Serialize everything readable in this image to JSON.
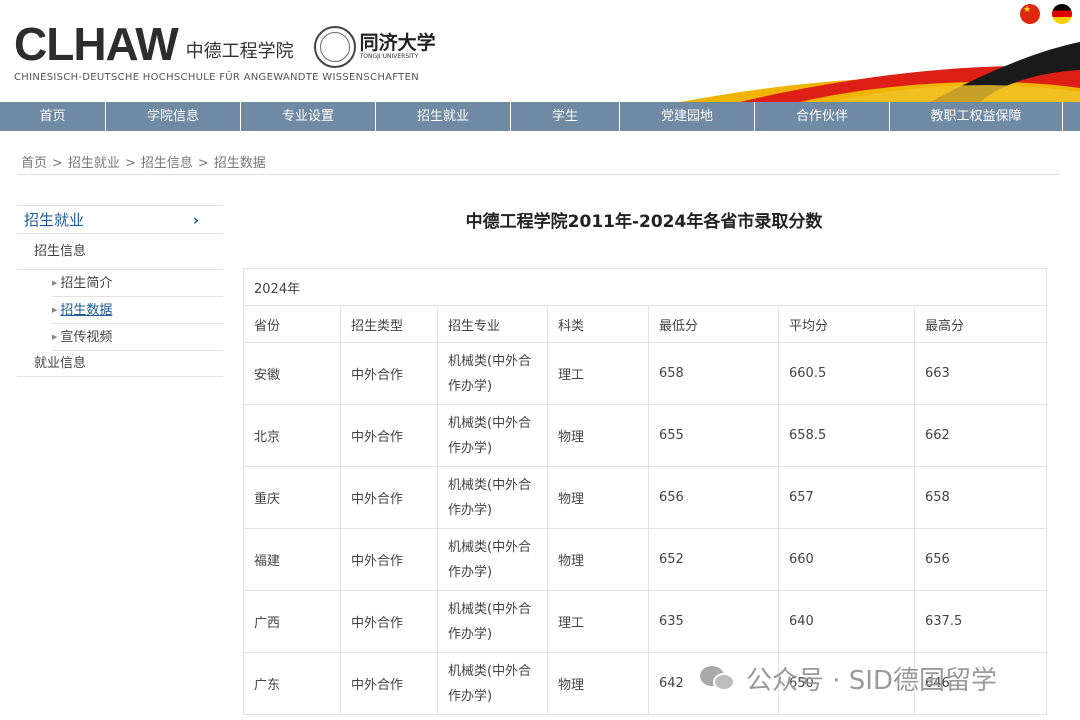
{
  "header": {
    "logo_text": "CLHAW",
    "logo_cn": "中德工程学院",
    "tongji_cn": "同济大学",
    "tongji_en": "TONGJI UNIVERSITY",
    "subtitle": "CHINESISCH-DEUTSCHE HOCHSCHULE FÜR ANGEWANDTE WISSENSCHAFTEN",
    "flags": [
      "china-flag-icon",
      "germany-flag-icon"
    ]
  },
  "nav": {
    "items": [
      {
        "label": "首页"
      },
      {
        "label": "学院信息"
      },
      {
        "label": "专业设置"
      },
      {
        "label": "招生就业"
      },
      {
        "label": "学生"
      },
      {
        "label": "党建园地"
      },
      {
        "label": "合作伙伴"
      },
      {
        "label": "教职工权益保障"
      }
    ]
  },
  "breadcrumb": {
    "items": [
      "首页",
      "招生就业",
      "招生信息",
      "招生数据"
    ],
    "sep": ">"
  },
  "sidebar": {
    "heading": "招生就业",
    "section1": "招生信息",
    "subitems": [
      "招生简介",
      "招生数据",
      "宣传视频"
    ],
    "section2": "就业信息"
  },
  "content": {
    "title": "中德工程学院2011年-2024年各省市录取分数",
    "year": "2024年",
    "headers": [
      "省份",
      "招生类型",
      "招生专业",
      "科类",
      "最低分",
      "平均分",
      "最高分"
    ],
    "rows": [
      {
        "province": "安徽",
        "type": "中外合作",
        "major": "机械类(中外合作办学)",
        "category": "理工",
        "min": "658",
        "avg": "660.5",
        "max": "663"
      },
      {
        "province": "北京",
        "type": "中外合作",
        "major": "机械类(中外合作办学)",
        "category": "物理",
        "min": "655",
        "avg": "658.5",
        "max": "662"
      },
      {
        "province": "重庆",
        "type": "中外合作",
        "major": "机械类(中外合作办学)",
        "category": "物理",
        "min": "656",
        "avg": "657",
        "max": "658"
      },
      {
        "province": "福建",
        "type": "中外合作",
        "major": "机械类(中外合作办学)",
        "category": "物理",
        "min": "652",
        "avg": "660",
        "max": "656"
      },
      {
        "province": "广西",
        "type": "中外合作",
        "major": "机械类(中外合作办学)",
        "category": "理工",
        "min": "635",
        "avg": "640",
        "max": "637.5"
      },
      {
        "province": "广东",
        "type": "中外合作",
        "major": "机械类(中外合作办学)",
        "category": "物理",
        "min": "642",
        "avg": "650",
        "max": "646"
      }
    ]
  },
  "watermark": {
    "text": "公众号 · SID德国留学"
  },
  "colors": {
    "nav_bg": "#6f8aa2",
    "link_blue": "#1d5b99",
    "flag_red": "#de2910"
  }
}
